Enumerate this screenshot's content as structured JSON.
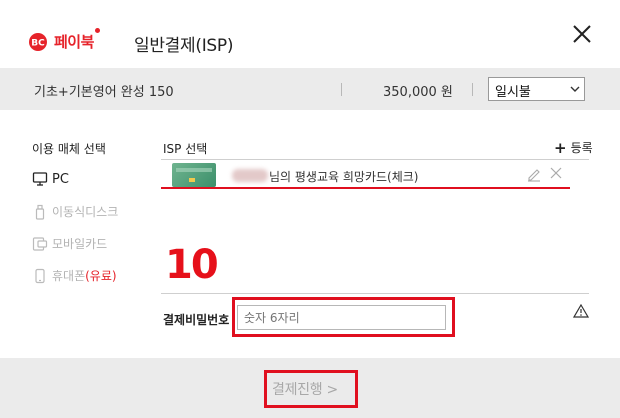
{
  "header": {
    "brand": "페이북",
    "title": "일반결제(ISP)",
    "brand_color": "#e6232a"
  },
  "product": {
    "name": "기초+기본영어 완성 150",
    "price": "350,000 원",
    "installment": "일시불"
  },
  "menu": {
    "title": "이용 매체 선택",
    "items": [
      {
        "label": "PC",
        "icon": "monitor-icon",
        "active": true
      },
      {
        "label": "이동식디스크",
        "icon": "usb-icon",
        "active": false
      },
      {
        "label": "모바일카드",
        "icon": "mobile-card-icon",
        "active": false
      },
      {
        "label": "휴대폰",
        "suffix": "(유료)",
        "icon": "phone-icon",
        "active": false
      }
    ]
  },
  "isp": {
    "title": "ISP 선택",
    "register_label": "등록",
    "card_label": "님의 평생교육 희망카드(체크)"
  },
  "annotation": {
    "step_number": "10",
    "highlight_color": "#e00f1f"
  },
  "password": {
    "label": "결제비밀번호",
    "placeholder": "숫자 6자리"
  },
  "footer": {
    "pay_label": "결제진행 >"
  }
}
